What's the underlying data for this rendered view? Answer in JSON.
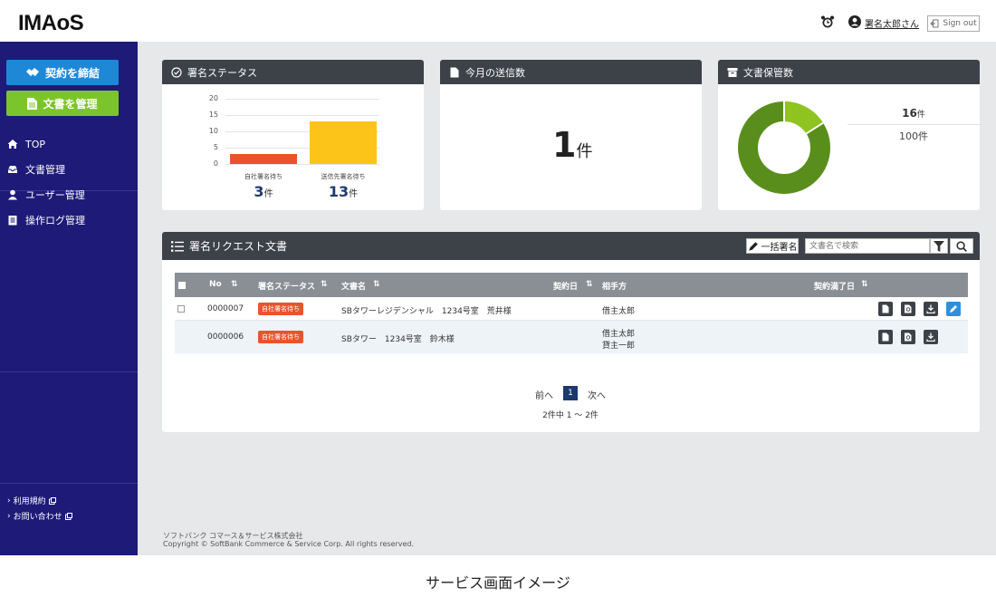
{
  "header": {
    "logo": "IMAoS",
    "user_name": "署名太郎さん",
    "signout_label": "Sign out"
  },
  "sidebar": {
    "primary_button": "契約を締結",
    "secondary_button": "文書を管理",
    "nav": [
      {
        "label": "TOP",
        "icon": "home-icon"
      },
      {
        "label": "文書管理",
        "icon": "inbox-icon"
      },
      {
        "label": "ユーザー管理",
        "icon": "user-icon"
      },
      {
        "label": "操作ログ管理",
        "icon": "clipboard-icon"
      }
    ],
    "footer_links": [
      "利用規約",
      "お問い合わせ"
    ]
  },
  "status_card": {
    "title": "署名ステータス",
    "bars": [
      {
        "label": "自社署名待ち",
        "value": 3,
        "unit": "件",
        "color": "#e8542d"
      },
      {
        "label": "送信先署名待ち",
        "value": 13,
        "unit": "件",
        "color": "#fcc419"
      }
    ],
    "ticks": [
      "20",
      "15",
      "10",
      "5",
      "0"
    ]
  },
  "chart_data": {
    "type": "bar",
    "categories": [
      "自社署名待ち",
      "送信先署名待ち"
    ],
    "values": [
      3,
      13
    ],
    "title": "署名ステータス",
    "xlabel": "",
    "ylabel": "",
    "ylim": [
      0,
      20
    ],
    "grid": true
  },
  "sent_card": {
    "title": "今月の送信数",
    "count": "1",
    "unit": "件"
  },
  "storage_card": {
    "title": "文書保管数",
    "used": "16",
    "used_unit": "件",
    "total": "100件",
    "used_fraction": 0.16,
    "colors": {
      "used": "#8fc31f",
      "remaining": "#5a8e1c"
    }
  },
  "request_table": {
    "title": "署名リクエスト文書",
    "bulk_sign_label": "一括署名",
    "search_placeholder": "文書名で検索",
    "columns": {
      "no": "No",
      "status": "署名ステータス",
      "doc_name": "文書名",
      "contract_date": "契約日",
      "party": "相手方",
      "expiry": "契約満了日"
    },
    "rows": [
      {
        "no": "0000007",
        "status": "自社署名待ち",
        "doc_name": "SBタワーレジデンシャル　1234号室　荒井様",
        "party_1": "借主太郎",
        "party_2": ""
      },
      {
        "no": "0000006",
        "status": "自社署名待ち",
        "doc_name": "SBタワー　1234号室　鈴木様",
        "party_1": "借主太郎",
        "party_2": "貸主一郎"
      }
    ],
    "pager": {
      "prev": "前へ",
      "current": "1",
      "next": "次へ",
      "info": "2件中 1 ～ 2件"
    }
  },
  "footer": {
    "company": "ソフトバンク コマース＆サービス株式会社",
    "copyright": "Copyright © SoftBank Commerce & Service Corp. All rights reserved."
  },
  "caption": "サービス画面イメージ"
}
